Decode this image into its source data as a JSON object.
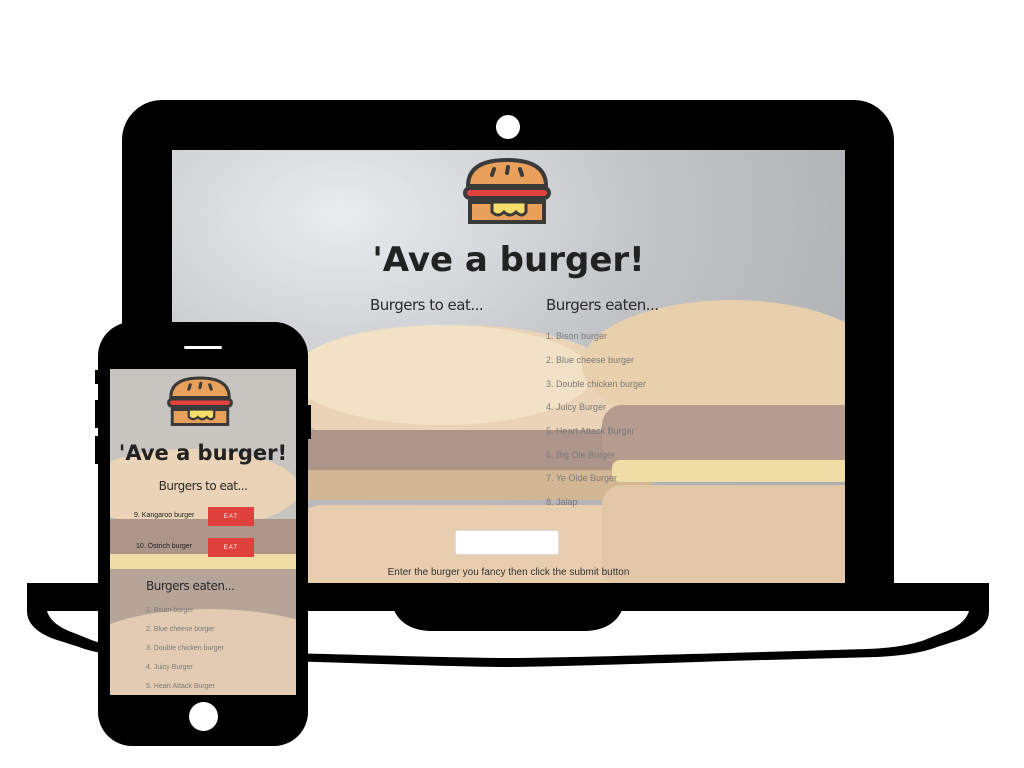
{
  "site": {
    "title": "'Ave a burger!",
    "logo_icon": "burger-icon"
  },
  "columns": {
    "to_eat_heading": "Burgers to eat...",
    "eaten_heading": "Burgers eaten..."
  },
  "laptop": {
    "eaten": [
      "1. Bison burger",
      "2. Blue cheese burger",
      "3. Double chicken burger",
      "4. Juicy Burger",
      "5. Heart Attack Burger",
      "6. Big Ole Burger",
      "7. Ye Olde Burger",
      "8. Jalap"
    ],
    "input_value": "",
    "instructions": "Enter the burger you fancy then click the submit button"
  },
  "phone": {
    "to_eat": [
      {
        "label": "9. Kangaroo burger",
        "button": "EAT"
      },
      {
        "label": "10. Ostrich burger",
        "button": "EAT"
      }
    ],
    "eaten": [
      "1. Bison burger",
      "2. Blue cheese burger",
      "3. Double chicken burger",
      "4. Juicy Burger",
      "5. Heart Attack Burger"
    ]
  },
  "colors": {
    "accent_button": "#e0413d",
    "bun": "#e8a05a",
    "tomato": "#e0433c",
    "cheese": "#f7dd6a",
    "device": "#000000"
  }
}
